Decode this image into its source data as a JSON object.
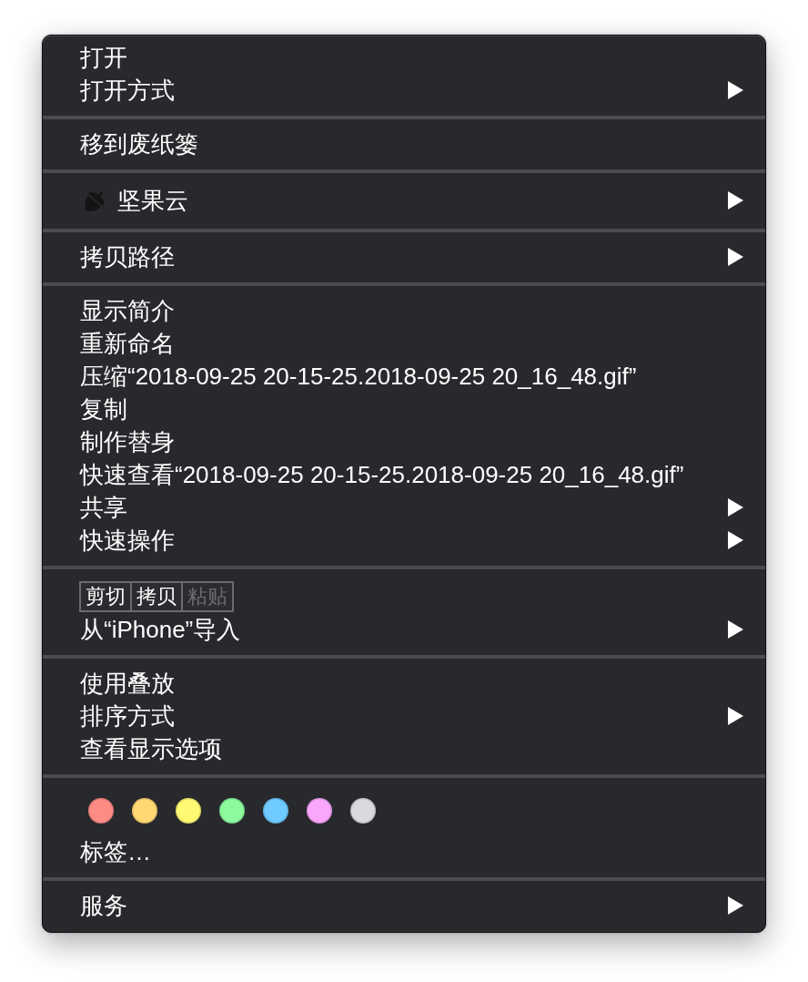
{
  "menu": {
    "sections": [
      {
        "items": [
          {
            "kind": "item",
            "label": "打开",
            "submenu": false
          },
          {
            "kind": "item",
            "label": "打开方式",
            "submenu": true
          }
        ]
      },
      {
        "items": [
          {
            "kind": "item",
            "label": "移到废纸篓",
            "submenu": false
          }
        ]
      },
      {
        "items": [
          {
            "kind": "icon_item",
            "label": "坚果云",
            "submenu": true
          }
        ]
      },
      {
        "items": [
          {
            "kind": "item",
            "label": "拷贝路径",
            "submenu": true
          }
        ]
      },
      {
        "items": [
          {
            "kind": "item",
            "label": "显示简介",
            "submenu": false
          },
          {
            "kind": "item",
            "label": "重新命名",
            "submenu": false
          },
          {
            "kind": "item",
            "label": "压缩“2018-09-25 20-15-25.2018-09-25 20_16_48.gif”",
            "submenu": false
          },
          {
            "kind": "item",
            "label": "复制",
            "submenu": false
          },
          {
            "kind": "item",
            "label": "制作替身",
            "submenu": false
          },
          {
            "kind": "item",
            "label": "快速查看“2018-09-25 20-15-25.2018-09-25 20_16_48.gif”",
            "submenu": false
          },
          {
            "kind": "item",
            "label": "共享",
            "submenu": true
          },
          {
            "kind": "item",
            "label": "快速操作",
            "submenu": true
          }
        ]
      },
      {
        "items": [
          {
            "kind": "edit_buttons",
            "buttons": [
              {
                "label": "剪切",
                "disabled": false
              },
              {
                "label": "拷贝",
                "disabled": false
              },
              {
                "label": "粘贴",
                "disabled": true
              }
            ]
          },
          {
            "kind": "item",
            "label": "从“iPhone”导入",
            "submenu": true
          }
        ]
      },
      {
        "items": [
          {
            "kind": "item",
            "label": "使用叠放",
            "submenu": false
          },
          {
            "kind": "item",
            "label": "排序方式",
            "submenu": true
          },
          {
            "kind": "item",
            "label": "查看显示选项",
            "submenu": false
          }
        ]
      },
      {
        "items": [
          {
            "kind": "tags",
            "tags": [
              {
                "color": "#ff8b85"
              },
              {
                "color": "#ffd873"
              },
              {
                "color": "#fffa72"
              },
              {
                "color": "#8efa9e"
              },
              {
                "color": "#6fcbff"
              },
              {
                "color": "#f9a6fb"
              },
              {
                "color": "#d9dadd"
              }
            ]
          },
          {
            "kind": "item",
            "label": "标签…",
            "submenu": false
          }
        ]
      },
      {
        "items": [
          {
            "kind": "item",
            "label": "服务",
            "submenu": true
          }
        ]
      }
    ]
  }
}
